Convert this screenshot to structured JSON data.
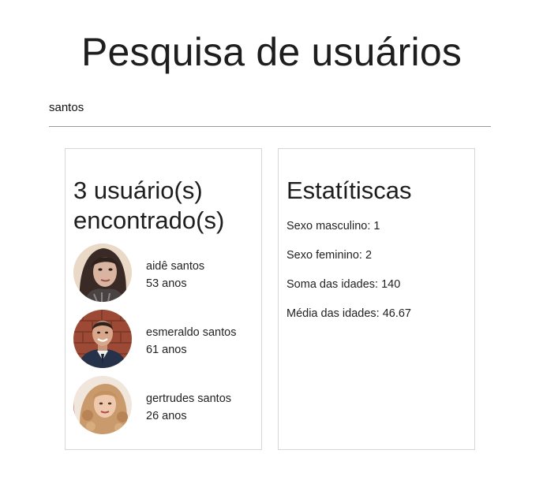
{
  "page": {
    "title": "Pesquisa de usuários"
  },
  "search": {
    "value": "santos"
  },
  "users": {
    "heading": "3 usuário(s) encontrado(s)",
    "items": [
      {
        "name": "aidê santos",
        "age": "53 anos",
        "avatar": "woman-dark-hair-photo"
      },
      {
        "name": "esmeraldo santos",
        "age": "61 anos",
        "avatar": "man-suit-brick-wall-photo"
      },
      {
        "name": "gertrudes santos",
        "age": "26 anos",
        "avatar": "woman-blonde-curly-photo"
      }
    ]
  },
  "stats": {
    "heading": "Estatítiscas",
    "male": "Sexo masculino: 1",
    "female": "Sexo feminino: 2",
    "age_sum": "Soma das idades: 140",
    "age_avg": "Média das idades: 46.67"
  }
}
